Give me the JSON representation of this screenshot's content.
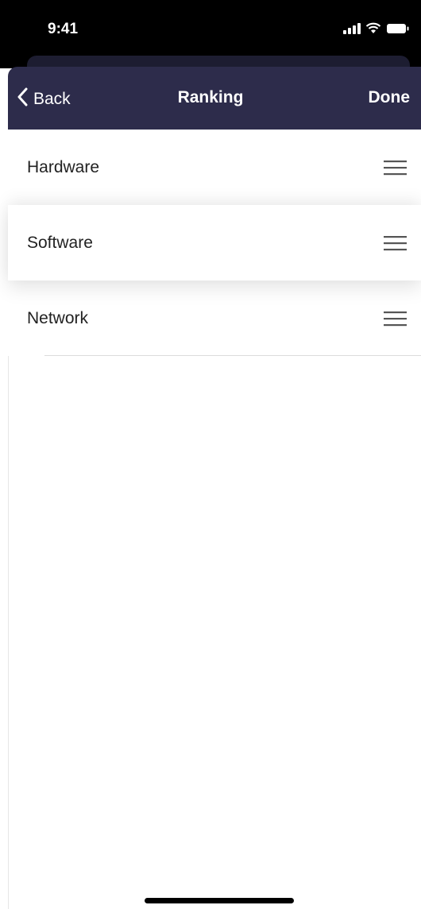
{
  "status_bar": {
    "time": "9:41",
    "icons": [
      "cellular-signal-icon",
      "wifi-icon",
      "battery-icon"
    ]
  },
  "nav": {
    "back_label": "Back",
    "title": "Ranking",
    "done_label": "Done",
    "background_color": "#2d2c4b"
  },
  "list": {
    "items": [
      {
        "label": "Hardware",
        "state": "normal"
      },
      {
        "label": "Software",
        "state": "dragging"
      },
      {
        "label": "Network",
        "state": "normal"
      }
    ]
  }
}
